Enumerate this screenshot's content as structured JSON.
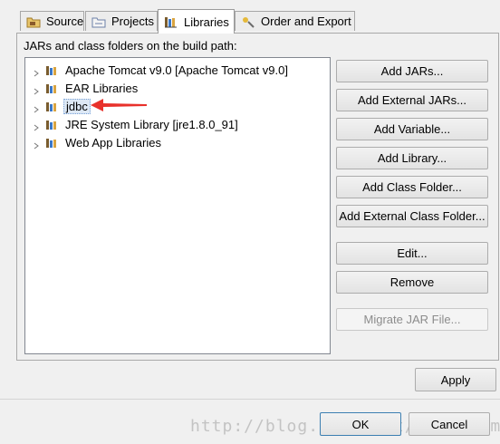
{
  "tabs": [
    {
      "label": "Source",
      "icon": "source-folder-icon"
    },
    {
      "label": "Projects",
      "icon": "projects-icon"
    },
    {
      "label": "Libraries",
      "icon": "libraries-icon",
      "active": true
    },
    {
      "label": "Order and Export",
      "icon": "order-export-icon"
    }
  ],
  "panel": {
    "label": "JARs and class folders on the build path:"
  },
  "tree": [
    {
      "label": "Apache Tomcat v9.0 [Apache Tomcat v9.0]",
      "icon": "library-icon"
    },
    {
      "label": "EAR Libraries",
      "icon": "library-icon"
    },
    {
      "label": "jdbc",
      "icon": "library-icon",
      "selected": true
    },
    {
      "label": "JRE System Library [jre1.8.0_91]",
      "icon": "library-icon"
    },
    {
      "label": "Web App Libraries",
      "icon": "library-icon"
    }
  ],
  "buttons": {
    "add_jars": "Add JARs...",
    "add_external_jars": "Add External JARs...",
    "add_variable": "Add Variable...",
    "add_library": "Add Library...",
    "add_class_folder": "Add Class Folder...",
    "add_external_class_folder": "Add External Class Folder...",
    "edit": "Edit...",
    "remove": "Remove",
    "migrate_jar": "Migrate JAR File..."
  },
  "footer": {
    "apply": "Apply",
    "ok": "OK",
    "cancel": "Cancel"
  },
  "watermark": "http://blog.csdn.net/fajiansmx",
  "colors": {
    "selection": "#dde8f5",
    "arrow": "#e8312b"
  }
}
